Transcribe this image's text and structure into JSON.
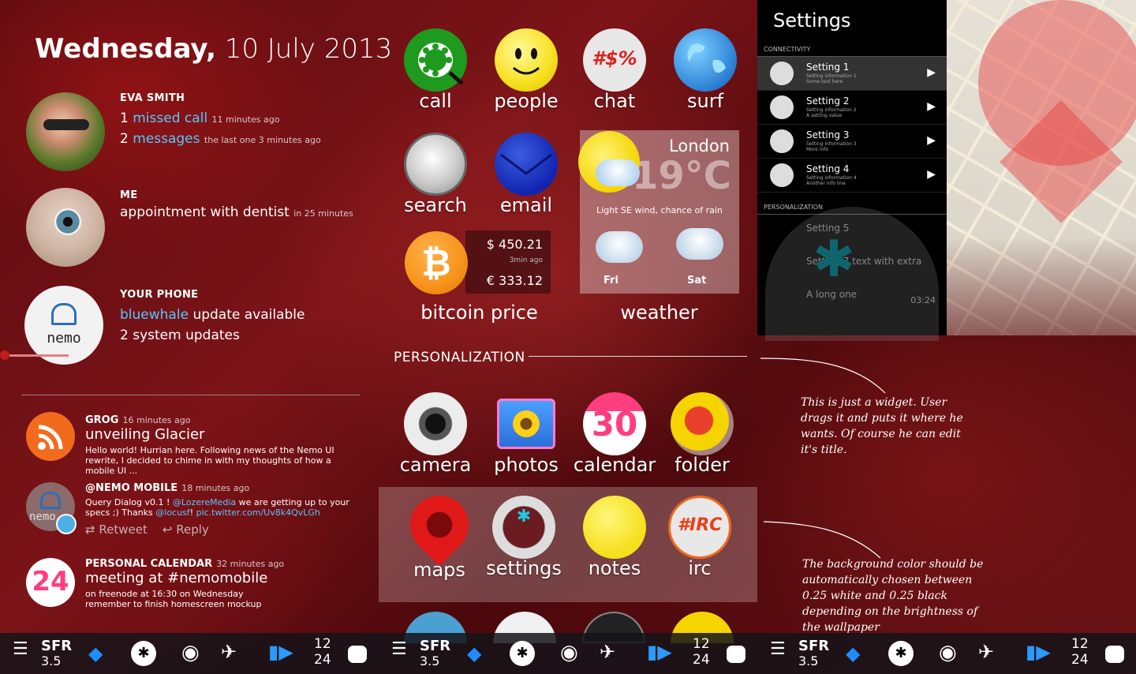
{
  "date": {
    "weekday": "Wednesday,",
    "date": "10 July 2013"
  },
  "people": [
    {
      "name": "EVA SMITH",
      "line1": {
        "count": "1",
        "link": "missed call",
        "meta": "11 minutes ago"
      },
      "line2": {
        "count": "2",
        "link": "messages",
        "meta": "the last one 3 minutes ago"
      }
    },
    {
      "name": "ME",
      "text": "appointment with dentist",
      "meta": "in 25 minutes"
    },
    {
      "name": "YOUR PHONE",
      "link": "bluewhale",
      "text": "update available",
      "line2": "2 system updates",
      "logo": "nemo"
    }
  ],
  "feed": [
    {
      "name": "GROG",
      "time": "16 minutes ago",
      "title": "unveiling Glacier",
      "body": "Hello world! Hurrian here. Following news of the Nemo UI rewrite, I decided to chime in with my thoughts of how a mobile UI ..."
    },
    {
      "name": "@NEMO MOBILE",
      "time": "18 minutes ago",
      "body1": "Query Dialog v0.1 ! ",
      "mention1": "@LozereMedia",
      "body2": " we are getting up to your specs ;) Thanks ",
      "mention2": "@locusf",
      "body3": "! ",
      "link": "pic.twitter.com/Uv8k4QvLGh",
      "retweet": "Retweet",
      "reply": "Reply",
      "logo": "nemo"
    },
    {
      "name": "PERSONAL CALENDAR",
      "time": "32 minutes ago",
      "title": "meeting at #nemomobile",
      "body": "on freenode at 16:30 on Wednesday remember to finish homescreen mockup",
      "day": "24"
    }
  ],
  "apps_top": [
    "call",
    "people",
    "chat",
    "surf",
    "search",
    "email"
  ],
  "chat_glyph": "#$%",
  "bitcoin": {
    "label": "bitcoin price",
    "usd": "$ 450.21",
    "ago": "3min ago",
    "eur": "€ 333.12"
  },
  "weather": {
    "label": "weather",
    "city": "London",
    "temp": "19°C",
    "desc": "Light SE wind, chance of rain",
    "days": [
      "Fri",
      "Sat"
    ]
  },
  "personalization": {
    "heading": "PERSONALIZATION",
    "apps": [
      "camera",
      "photos",
      "calendar",
      "folder"
    ],
    "calendar_day": "30"
  },
  "folder_apps": [
    "maps",
    "settings",
    "notes",
    "irc"
  ],
  "irc_glyph": "#IRC",
  "settings": {
    "title": "Settings",
    "section1": "CONNECTIVITY",
    "rows": [
      {
        "title": "Setting 1",
        "sub1": "Setting information 1",
        "sub2": "Some text here"
      },
      {
        "title": "Setting 2",
        "sub1": "Setting information 2",
        "sub2": "A setting value"
      },
      {
        "title": "Setting 3",
        "sub1": "Setting information 3",
        "sub2": "More info"
      },
      {
        "title": "Setting 4",
        "sub1": "Setting information 4",
        "sub2": "Another info line"
      }
    ],
    "section2": "PERSONALIZATION",
    "rows2": [
      "Setting 5",
      "Setting 7 text with extra",
      "A long one"
    ],
    "time": "03:24"
  },
  "annotations": {
    "a1": "This is just a widget. User drags it and puts it where he wants. Of course he can edit it's title.",
    "a2": "The background color should be automatically chosen between 0.25 white and 0.25 black depending on the brightness of the wallpaper"
  },
  "status": {
    "carrier": "SFR",
    "network": "3.5",
    "hour": "12",
    "min": "24"
  },
  "colors": {
    "accent": "#55c8ff",
    "bitcoin": "#f7931a",
    "calendar": "#ff3d7f"
  }
}
